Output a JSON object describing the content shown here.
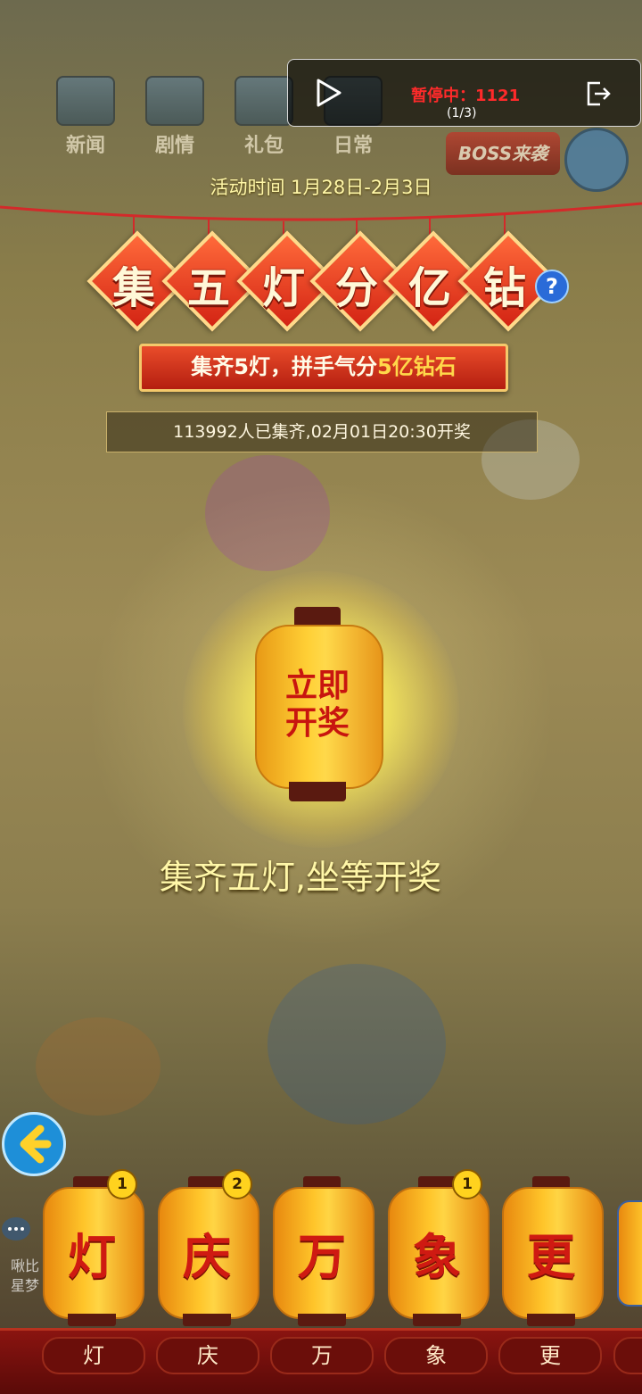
{
  "top_icons": [
    {
      "label": "新闻",
      "icon": "news-icon"
    },
    {
      "label": "剧情",
      "icon": "story-icon"
    },
    {
      "label": "礼包",
      "icon": "gift-icon"
    },
    {
      "label": "日常",
      "icon": "daily-icon"
    }
  ],
  "boss_button": {
    "label": "BOSS来袭"
  },
  "overlay": {
    "status": "暂停中：1121",
    "page": "(1/3)",
    "play_icon": "play-icon",
    "exit_icon": "exit-icon"
  },
  "activity_time": "活动时间 1月28日-2月3日",
  "title_chars": [
    "集",
    "五",
    "灯",
    "分",
    "亿",
    "钻"
  ],
  "help_label": "?",
  "banner": {
    "part1": "集齐5灯，拼手气分",
    "highlight": "5亿钻石"
  },
  "collected_text": "113992人已集齐,02月01日20:30开奖",
  "big_lantern": {
    "line1": "立即",
    "line2": "开奖"
  },
  "wait_text": "集齐五灯,坐等开奖",
  "lanterns": [
    {
      "char": "灯",
      "count": "1",
      "label": "灯"
    },
    {
      "char": "庆",
      "count": "2",
      "label": "庆"
    },
    {
      "char": "万",
      "count": "",
      "label": "万"
    },
    {
      "char": "象",
      "count": "1",
      "label": "象"
    },
    {
      "char": "更",
      "count": "",
      "label": "更"
    }
  ],
  "side_text": {
    "line1": "啾比",
    "line2": "星梦"
  },
  "colors": {
    "accent_red": "#d32414",
    "gold": "#ffd84a",
    "pause_red": "#ff2a2a"
  }
}
